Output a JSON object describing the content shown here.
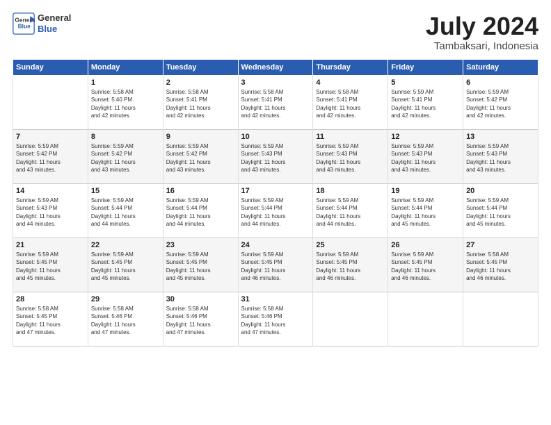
{
  "logo": {
    "line1": "General",
    "line2": "Blue"
  },
  "title": "July 2024",
  "subtitle": "Tambaksari, Indonesia",
  "header_days": [
    "Sunday",
    "Monday",
    "Tuesday",
    "Wednesday",
    "Thursday",
    "Friday",
    "Saturday"
  ],
  "weeks": [
    [
      {
        "day": "",
        "text": ""
      },
      {
        "day": "1",
        "text": "Sunrise: 5:58 AM\nSunset: 5:40 PM\nDaylight: 11 hours\nand 42 minutes."
      },
      {
        "day": "2",
        "text": "Sunrise: 5:58 AM\nSunset: 5:41 PM\nDaylight: 11 hours\nand 42 minutes."
      },
      {
        "day": "3",
        "text": "Sunrise: 5:58 AM\nSunset: 5:41 PM\nDaylight: 11 hours\nand 42 minutes."
      },
      {
        "day": "4",
        "text": "Sunrise: 5:58 AM\nSunset: 5:41 PM\nDaylight: 11 hours\nand 42 minutes."
      },
      {
        "day": "5",
        "text": "Sunrise: 5:59 AM\nSunset: 5:41 PM\nDaylight: 11 hours\nand 42 minutes."
      },
      {
        "day": "6",
        "text": "Sunrise: 5:59 AM\nSunset: 5:42 PM\nDaylight: 11 hours\nand 42 minutes."
      }
    ],
    [
      {
        "day": "7",
        "text": "Sunrise: 5:59 AM\nSunset: 5:42 PM\nDaylight: 11 hours\nand 43 minutes."
      },
      {
        "day": "8",
        "text": "Sunrise: 5:59 AM\nSunset: 5:42 PM\nDaylight: 11 hours\nand 43 minutes."
      },
      {
        "day": "9",
        "text": "Sunrise: 5:59 AM\nSunset: 5:42 PM\nDaylight: 11 hours\nand 43 minutes."
      },
      {
        "day": "10",
        "text": "Sunrise: 5:59 AM\nSunset: 5:43 PM\nDaylight: 11 hours\nand 43 minutes."
      },
      {
        "day": "11",
        "text": "Sunrise: 5:59 AM\nSunset: 5:43 PM\nDaylight: 11 hours\nand 43 minutes."
      },
      {
        "day": "12",
        "text": "Sunrise: 5:59 AM\nSunset: 5:43 PM\nDaylight: 11 hours\nand 43 minutes."
      },
      {
        "day": "13",
        "text": "Sunrise: 5:59 AM\nSunset: 5:43 PM\nDaylight: 11 hours\nand 43 minutes."
      }
    ],
    [
      {
        "day": "14",
        "text": "Sunrise: 5:59 AM\nSunset: 5:43 PM\nDaylight: 11 hours\nand 44 minutes."
      },
      {
        "day": "15",
        "text": "Sunrise: 5:59 AM\nSunset: 5:44 PM\nDaylight: 11 hours\nand 44 minutes."
      },
      {
        "day": "16",
        "text": "Sunrise: 5:59 AM\nSunset: 5:44 PM\nDaylight: 11 hours\nand 44 minutes."
      },
      {
        "day": "17",
        "text": "Sunrise: 5:59 AM\nSunset: 5:44 PM\nDaylight: 11 hours\nand 44 minutes."
      },
      {
        "day": "18",
        "text": "Sunrise: 5:59 AM\nSunset: 5:44 PM\nDaylight: 11 hours\nand 44 minutes."
      },
      {
        "day": "19",
        "text": "Sunrise: 5:59 AM\nSunset: 5:44 PM\nDaylight: 11 hours\nand 45 minutes."
      },
      {
        "day": "20",
        "text": "Sunrise: 5:59 AM\nSunset: 5:44 PM\nDaylight: 11 hours\nand 45 minutes."
      }
    ],
    [
      {
        "day": "21",
        "text": "Sunrise: 5:59 AM\nSunset: 5:45 PM\nDaylight: 11 hours\nand 45 minutes."
      },
      {
        "day": "22",
        "text": "Sunrise: 5:59 AM\nSunset: 5:45 PM\nDaylight: 11 hours\nand 45 minutes."
      },
      {
        "day": "23",
        "text": "Sunrise: 5:59 AM\nSunset: 5:45 PM\nDaylight: 11 hours\nand 45 minutes."
      },
      {
        "day": "24",
        "text": "Sunrise: 5:59 AM\nSunset: 5:45 PM\nDaylight: 11 hours\nand 46 minutes."
      },
      {
        "day": "25",
        "text": "Sunrise: 5:59 AM\nSunset: 5:45 PM\nDaylight: 11 hours\nand 46 minutes."
      },
      {
        "day": "26",
        "text": "Sunrise: 5:59 AM\nSunset: 5:45 PM\nDaylight: 11 hours\nand 46 minutes."
      },
      {
        "day": "27",
        "text": "Sunrise: 5:58 AM\nSunset: 5:45 PM\nDaylight: 11 hours\nand 46 minutes."
      }
    ],
    [
      {
        "day": "28",
        "text": "Sunrise: 5:58 AM\nSunset: 5:45 PM\nDaylight: 11 hours\nand 47 minutes."
      },
      {
        "day": "29",
        "text": "Sunrise: 5:58 AM\nSunset: 5:46 PM\nDaylight: 11 hours\nand 47 minutes."
      },
      {
        "day": "30",
        "text": "Sunrise: 5:58 AM\nSunset: 5:46 PM\nDaylight: 11 hours\nand 47 minutes."
      },
      {
        "day": "31",
        "text": "Sunrise: 5:58 AM\nSunset: 5:46 PM\nDaylight: 11 hours\nand 47 minutes."
      },
      {
        "day": "",
        "text": ""
      },
      {
        "day": "",
        "text": ""
      },
      {
        "day": "",
        "text": ""
      }
    ]
  ]
}
